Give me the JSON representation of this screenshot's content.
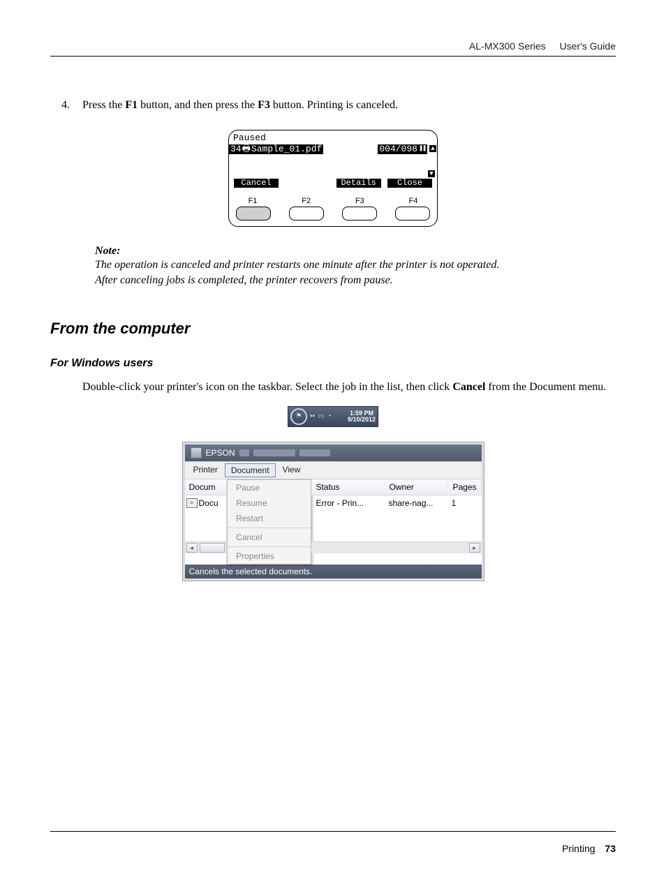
{
  "header": {
    "product": "AL-MX300 Series",
    "doc": "User's Guide"
  },
  "footer": {
    "chapter": "Printing",
    "page": "73"
  },
  "step": {
    "number": "4.",
    "pre": "Press the ",
    "b1": "F1",
    "mid": " button, and then press the ",
    "b2": "F3",
    "post": " button. Printing is canceled."
  },
  "lcd": {
    "status": "Paused",
    "job_num": "34",
    "job_name": "Sample_01.pdf",
    "progress": "004/098",
    "soft1": "Cancel",
    "soft3": "Details",
    "soft4": "Close",
    "f1": "F1",
    "f2": "F2",
    "f3": "F3",
    "f4": "F4"
  },
  "note": {
    "title": "Note:",
    "line1": "The operation is canceled and printer restarts one minute after the printer is not operated.",
    "line2": "After canceling jobs is completed, the printer recovers from pause."
  },
  "h2": "From the computer",
  "h3": "For Windows users",
  "para": {
    "pre": "Double-click your printer's icon on the taskbar. Select the job in the list, then click ",
    "bold": "Cancel",
    "post": " from the Document menu."
  },
  "tray": {
    "time": "1:59 PM",
    "date": "9/10/2012"
  },
  "win": {
    "title": "EPSON",
    "menu": {
      "printer": "Printer",
      "document": "Document",
      "view": "View"
    },
    "left_hdr": "Docum",
    "left_row": "Docu",
    "cols": {
      "status": "Status",
      "owner": "Owner",
      "pages": "Pages"
    },
    "row": {
      "status": "Error - Prin...",
      "owner": "share-nag...",
      "pages": "1"
    },
    "menu_items": {
      "pause": "Pause",
      "resume": "Resume",
      "restart": "Restart",
      "cancel": "Cancel",
      "properties": "Properties"
    },
    "statusbar": "Cancels the selected documents."
  }
}
